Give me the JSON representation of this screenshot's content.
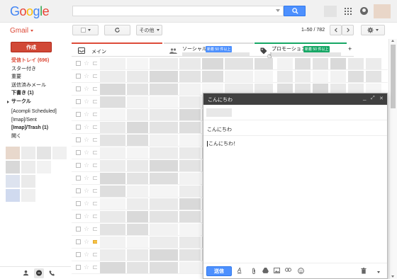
{
  "topbar": {
    "logo_letters": [
      {
        "ch": "G",
        "color": "#4285f4"
      },
      {
        "ch": "o",
        "color": "#ea4335"
      },
      {
        "ch": "o",
        "color": "#fbbc05"
      },
      {
        "ch": "g",
        "color": "#4285f4"
      },
      {
        "ch": "l",
        "color": "#34a853"
      },
      {
        "ch": "e",
        "color": "#ea4335"
      }
    ],
    "search_value": "",
    "apps_icon": "apps-grid-icon",
    "account_icon": "account-circle-icon"
  },
  "toolbar": {
    "app_label": "Gmail",
    "refresh_icon": "refresh-icon",
    "more_label": "その他",
    "page_count": "1–50 / 782",
    "prev_icon": "chevron-left-icon",
    "next_icon": "chevron-right-icon",
    "settings_icon": "gear-icon"
  },
  "sidebar": {
    "compose_label": "作成",
    "items": [
      {
        "label": "受信トレイ (696)",
        "state": "active"
      },
      {
        "label": "スター付き",
        "state": ""
      },
      {
        "label": "重要",
        "state": ""
      },
      {
        "label": "送信済みメール",
        "state": ""
      },
      {
        "label": "下書き (1)",
        "state": "bold"
      },
      {
        "label": "サークル",
        "state": "bold"
      },
      {
        "label": "[Acompli Scheduled]",
        "state": ""
      },
      {
        "label": "[Imap]/Sent",
        "state": ""
      },
      {
        "label": "[Imap]/Trash (1)",
        "state": "bold"
      },
      {
        "label": "開く",
        "state": ""
      }
    ]
  },
  "tabs": [
    {
      "label": "メイン",
      "icon": "inbox-icon",
      "badge": ""
    },
    {
      "label": "ソーシャル",
      "icon": "people-icon",
      "badge": "新着 50 件以上",
      "badge_color": "#4d90fe"
    },
    {
      "label": "プロモーション",
      "icon": "tag-icon",
      "badge": "新着 50 件以上",
      "badge_color": "#16a765"
    }
  ],
  "tab_add_label": "+",
  "compose_window": {
    "title": "こんにちわ",
    "subject": "こんにちわ",
    "body": "こんにちわ！",
    "send_label": "送信",
    "minimize": "_",
    "expand": "⤢",
    "close": "✕"
  },
  "colors": {
    "accent_red": "#dd4b39",
    "send_blue": "#4d90fe",
    "promo_green": "#16a765"
  }
}
